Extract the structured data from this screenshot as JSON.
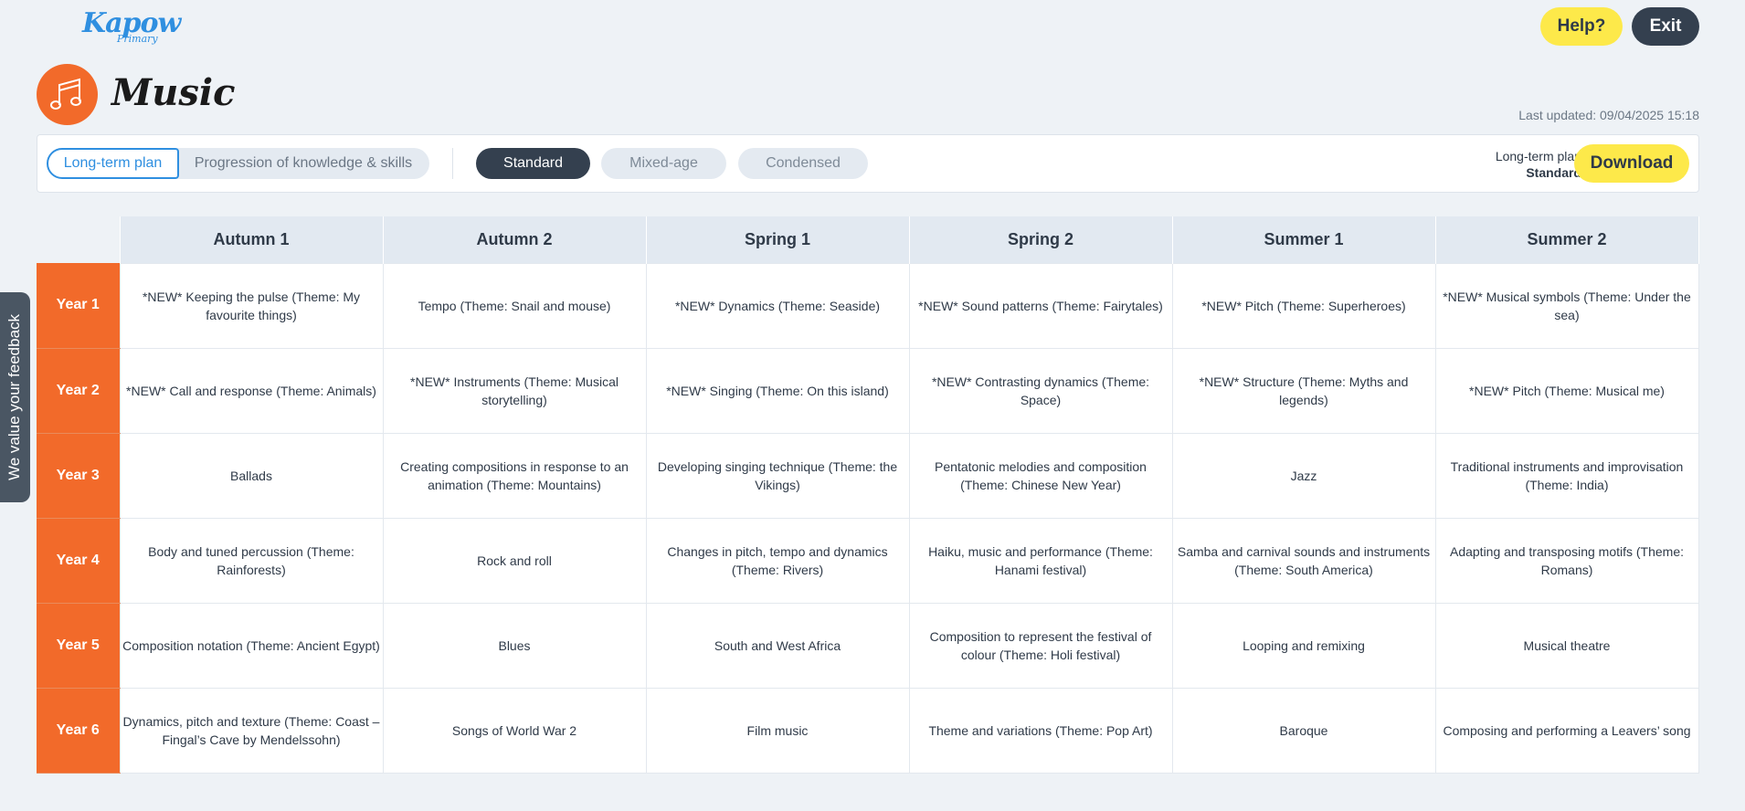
{
  "header": {
    "logo_main": "Kapow",
    "logo_sub": "Primary",
    "help_label": "Help?",
    "exit_label": "Exit",
    "subject_icon": "music-notes-icon",
    "subject_title": "Music",
    "last_updated": "Last updated: 09/04/2025 15:18"
  },
  "toolbar": {
    "tabs": [
      {
        "label": "Long-term plan",
        "active": true
      },
      {
        "label": "Progression of knowledge & skills",
        "active": false
      }
    ],
    "styles": [
      {
        "label": "Standard",
        "active": true
      },
      {
        "label": "Mixed-age",
        "active": false
      },
      {
        "label": "Condensed",
        "active": false
      }
    ],
    "download_info_line1": "Long-term plan",
    "download_info_line2": "Standard",
    "download_label": "Download"
  },
  "feedback": {
    "label": "We value your feedback"
  },
  "colors": {
    "accent_orange": "#f26a2a",
    "accent_yellow": "#fde94a",
    "dark": "#34404f",
    "link_blue": "#2f8fe0"
  },
  "table": {
    "terms": [
      "Autumn 1",
      "Autumn 2",
      "Spring 1",
      "Spring 2",
      "Summer 1",
      "Summer 2"
    ],
    "rows": [
      {
        "year": "Year 1",
        "cells": [
          "*NEW* Keeping the pulse (Theme: My favourite things)",
          "Tempo (Theme: Snail and mouse)",
          "*NEW* Dynamics (Theme: Seaside)",
          "*NEW* Sound patterns (Theme: Fairytales)",
          "*NEW* Pitch (Theme: Superheroes)",
          "*NEW* Musical symbols (Theme: Under the sea)"
        ]
      },
      {
        "year": "Year 2",
        "cells": [
          "*NEW* Call and response (Theme: Animals)",
          "*NEW* Instruments (Theme: Musical storytelling)",
          "*NEW* Singing (Theme: On this island)",
          "*NEW* Contrasting dynamics (Theme: Space)",
          "*NEW* Structure (Theme: Myths and legends)",
          "*NEW* Pitch (Theme: Musical me)"
        ]
      },
      {
        "year": "Year 3",
        "cells": [
          "Ballads",
          "Creating compositions in response to an animation (Theme: Mountains)",
          "Developing singing technique (Theme: the Vikings)",
          "Pentatonic melodies and composition (Theme: Chinese New Year)",
          "Jazz",
          "Traditional instruments and improvisation (Theme: India)"
        ]
      },
      {
        "year": "Year 4",
        "cells": [
          "Body and tuned percussion (Theme: Rainforests)",
          "Rock and roll",
          "Changes in pitch, tempo and dynamics (Theme: Rivers)",
          "Haiku, music and performance (Theme: Hanami festival)",
          "Samba and carnival sounds and instruments (Theme: South America)",
          "Adapting and transposing motifs (Theme: Romans)"
        ]
      },
      {
        "year": "Year 5",
        "cells": [
          "Composition notation (Theme: Ancient Egypt)",
          "Blues",
          "South and West Africa",
          "Composition to represent the festival of colour (Theme: Holi festival)",
          "Looping and remixing",
          "Musical theatre"
        ]
      },
      {
        "year": "Year 6",
        "cells": [
          "Dynamics, pitch and texture (Theme: Coast – Fingal’s Cave by Mendelssohn)",
          "Songs of World War 2",
          "Film music",
          "Theme and variations (Theme: Pop Art)",
          "Baroque",
          "Composing and performing a Leavers’ song"
        ]
      }
    ]
  }
}
